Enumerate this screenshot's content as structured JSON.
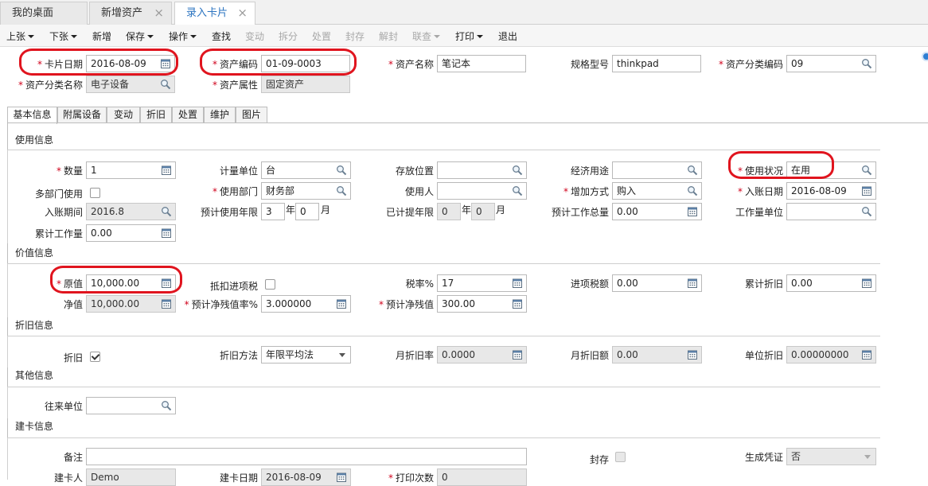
{
  "tabs": [
    "我的桌面",
    "新增资产",
    "录入卡片"
  ],
  "toolbar": [
    {
      "label": "上张",
      "dropdown": true,
      "disabled": false
    },
    {
      "label": "下张",
      "dropdown": true,
      "disabled": false
    },
    {
      "label": "新增",
      "dropdown": false,
      "disabled": false
    },
    {
      "label": "保存",
      "dropdown": true,
      "disabled": false
    },
    {
      "label": "操作",
      "dropdown": true,
      "disabled": false
    },
    {
      "label": "查找",
      "dropdown": false,
      "disabled": false
    },
    {
      "label": "变动",
      "dropdown": false,
      "disabled": true
    },
    {
      "label": "拆分",
      "dropdown": false,
      "disabled": true
    },
    {
      "label": "处置",
      "dropdown": false,
      "disabled": true
    },
    {
      "label": "封存",
      "dropdown": false,
      "disabled": true
    },
    {
      "label": "解封",
      "dropdown": false,
      "disabled": true
    },
    {
      "label": "联查",
      "dropdown": true,
      "disabled": true
    },
    {
      "label": "打印",
      "dropdown": true,
      "disabled": false
    },
    {
      "label": "退出",
      "dropdown": false,
      "disabled": false
    }
  ],
  "header": {
    "card_date": {
      "label": "卡片日期",
      "value": "2016-08-09"
    },
    "asset_code": {
      "label": "资产编码",
      "value": "01-09-0003"
    },
    "asset_name": {
      "label": "资产名称",
      "value": "笔记本"
    },
    "spec_model": {
      "label": "规格型号",
      "value": "thinkpad"
    },
    "category_code": {
      "label": "资产分类编码",
      "value": "09"
    },
    "category_name": {
      "label": "资产分类名称",
      "value": "电子设备"
    },
    "asset_attr": {
      "label": "资产属性",
      "value": "固定资产"
    }
  },
  "info_tabs": [
    "基本信息",
    "附属设备",
    "变动",
    "折旧",
    "处置",
    "维护",
    "图片"
  ],
  "sections": {
    "usage": "使用信息",
    "value": "价值信息",
    "depreciation": "折旧信息",
    "other": "其他信息",
    "card": "建卡信息"
  },
  "usage": {
    "quantity": {
      "label": "数量",
      "value": "1"
    },
    "unit": {
      "label": "计量单位",
      "value": "台"
    },
    "location": {
      "label": "存放位置",
      "value": ""
    },
    "econ_use": {
      "label": "经济用途",
      "value": ""
    },
    "status": {
      "label": "使用状况",
      "value": "在用"
    },
    "multi_dept": {
      "label": "多部门使用"
    },
    "dept": {
      "label": "使用部门",
      "value": "财务部"
    },
    "user": {
      "label": "使用人",
      "value": ""
    },
    "add_method": {
      "label": "增加方式",
      "value": "购入"
    },
    "entry_date": {
      "label": "入账日期",
      "value": "2016-08-09"
    },
    "entry_period": {
      "label": "入账期间",
      "value": "2016.8"
    },
    "life": {
      "label": "预计使用年限",
      "years": "3",
      "year_unit": "年",
      "months": "0",
      "month_unit": "月"
    },
    "accrued": {
      "label": "已计提年限",
      "years": "0",
      "year_unit": "年",
      "months": "0",
      "month_unit": "月"
    },
    "total_work": {
      "label": "预计工作总量",
      "value": "0.00"
    },
    "work_unit": {
      "label": "工作量单位",
      "value": ""
    },
    "cum_work": {
      "label": "累计工作量",
      "value": "0.00"
    }
  },
  "value": {
    "original": {
      "label": "原值",
      "value": "10,000.00"
    },
    "deduct_tax": {
      "label": "抵扣进项税"
    },
    "tax_rate": {
      "label": "税率%",
      "value": "17"
    },
    "input_tax": {
      "label": "进项税额",
      "value": "0.00"
    },
    "cum_depr": {
      "label": "累计折旧",
      "value": "0.00"
    },
    "net": {
      "label": "净值",
      "value": "10,000.00"
    },
    "salvage_rate": {
      "label": "预计净残值率%",
      "value": "3.000000"
    },
    "salvage": {
      "label": "预计净残值",
      "value": "300.00"
    }
  },
  "depreciation": {
    "depr": {
      "label": "折旧"
    },
    "method": {
      "label": "折旧方法",
      "value": "年限平均法"
    },
    "monthly_rate": {
      "label": "月折旧率",
      "value": "0.0000"
    },
    "monthly_amount": {
      "label": "月折旧额",
      "value": "0.00"
    },
    "unit_depr": {
      "label": "单位折旧",
      "value": "0.00000000"
    }
  },
  "other": {
    "partner": {
      "label": "往来单位",
      "value": ""
    }
  },
  "card": {
    "remark": {
      "label": "备注",
      "value": ""
    },
    "sealed": {
      "label": "封存"
    },
    "gen_voucher": {
      "label": "生成凭证",
      "value": "否"
    },
    "creator": {
      "label": "建卡人",
      "value": "Demo"
    },
    "create_date": {
      "label": "建卡日期",
      "value": "2016-08-09"
    },
    "print_count": {
      "label": "打印次数",
      "value": "0"
    }
  },
  "colors": {
    "accent": "#2a73c0",
    "required": "#d0021b",
    "highlight": "#e0141e"
  }
}
